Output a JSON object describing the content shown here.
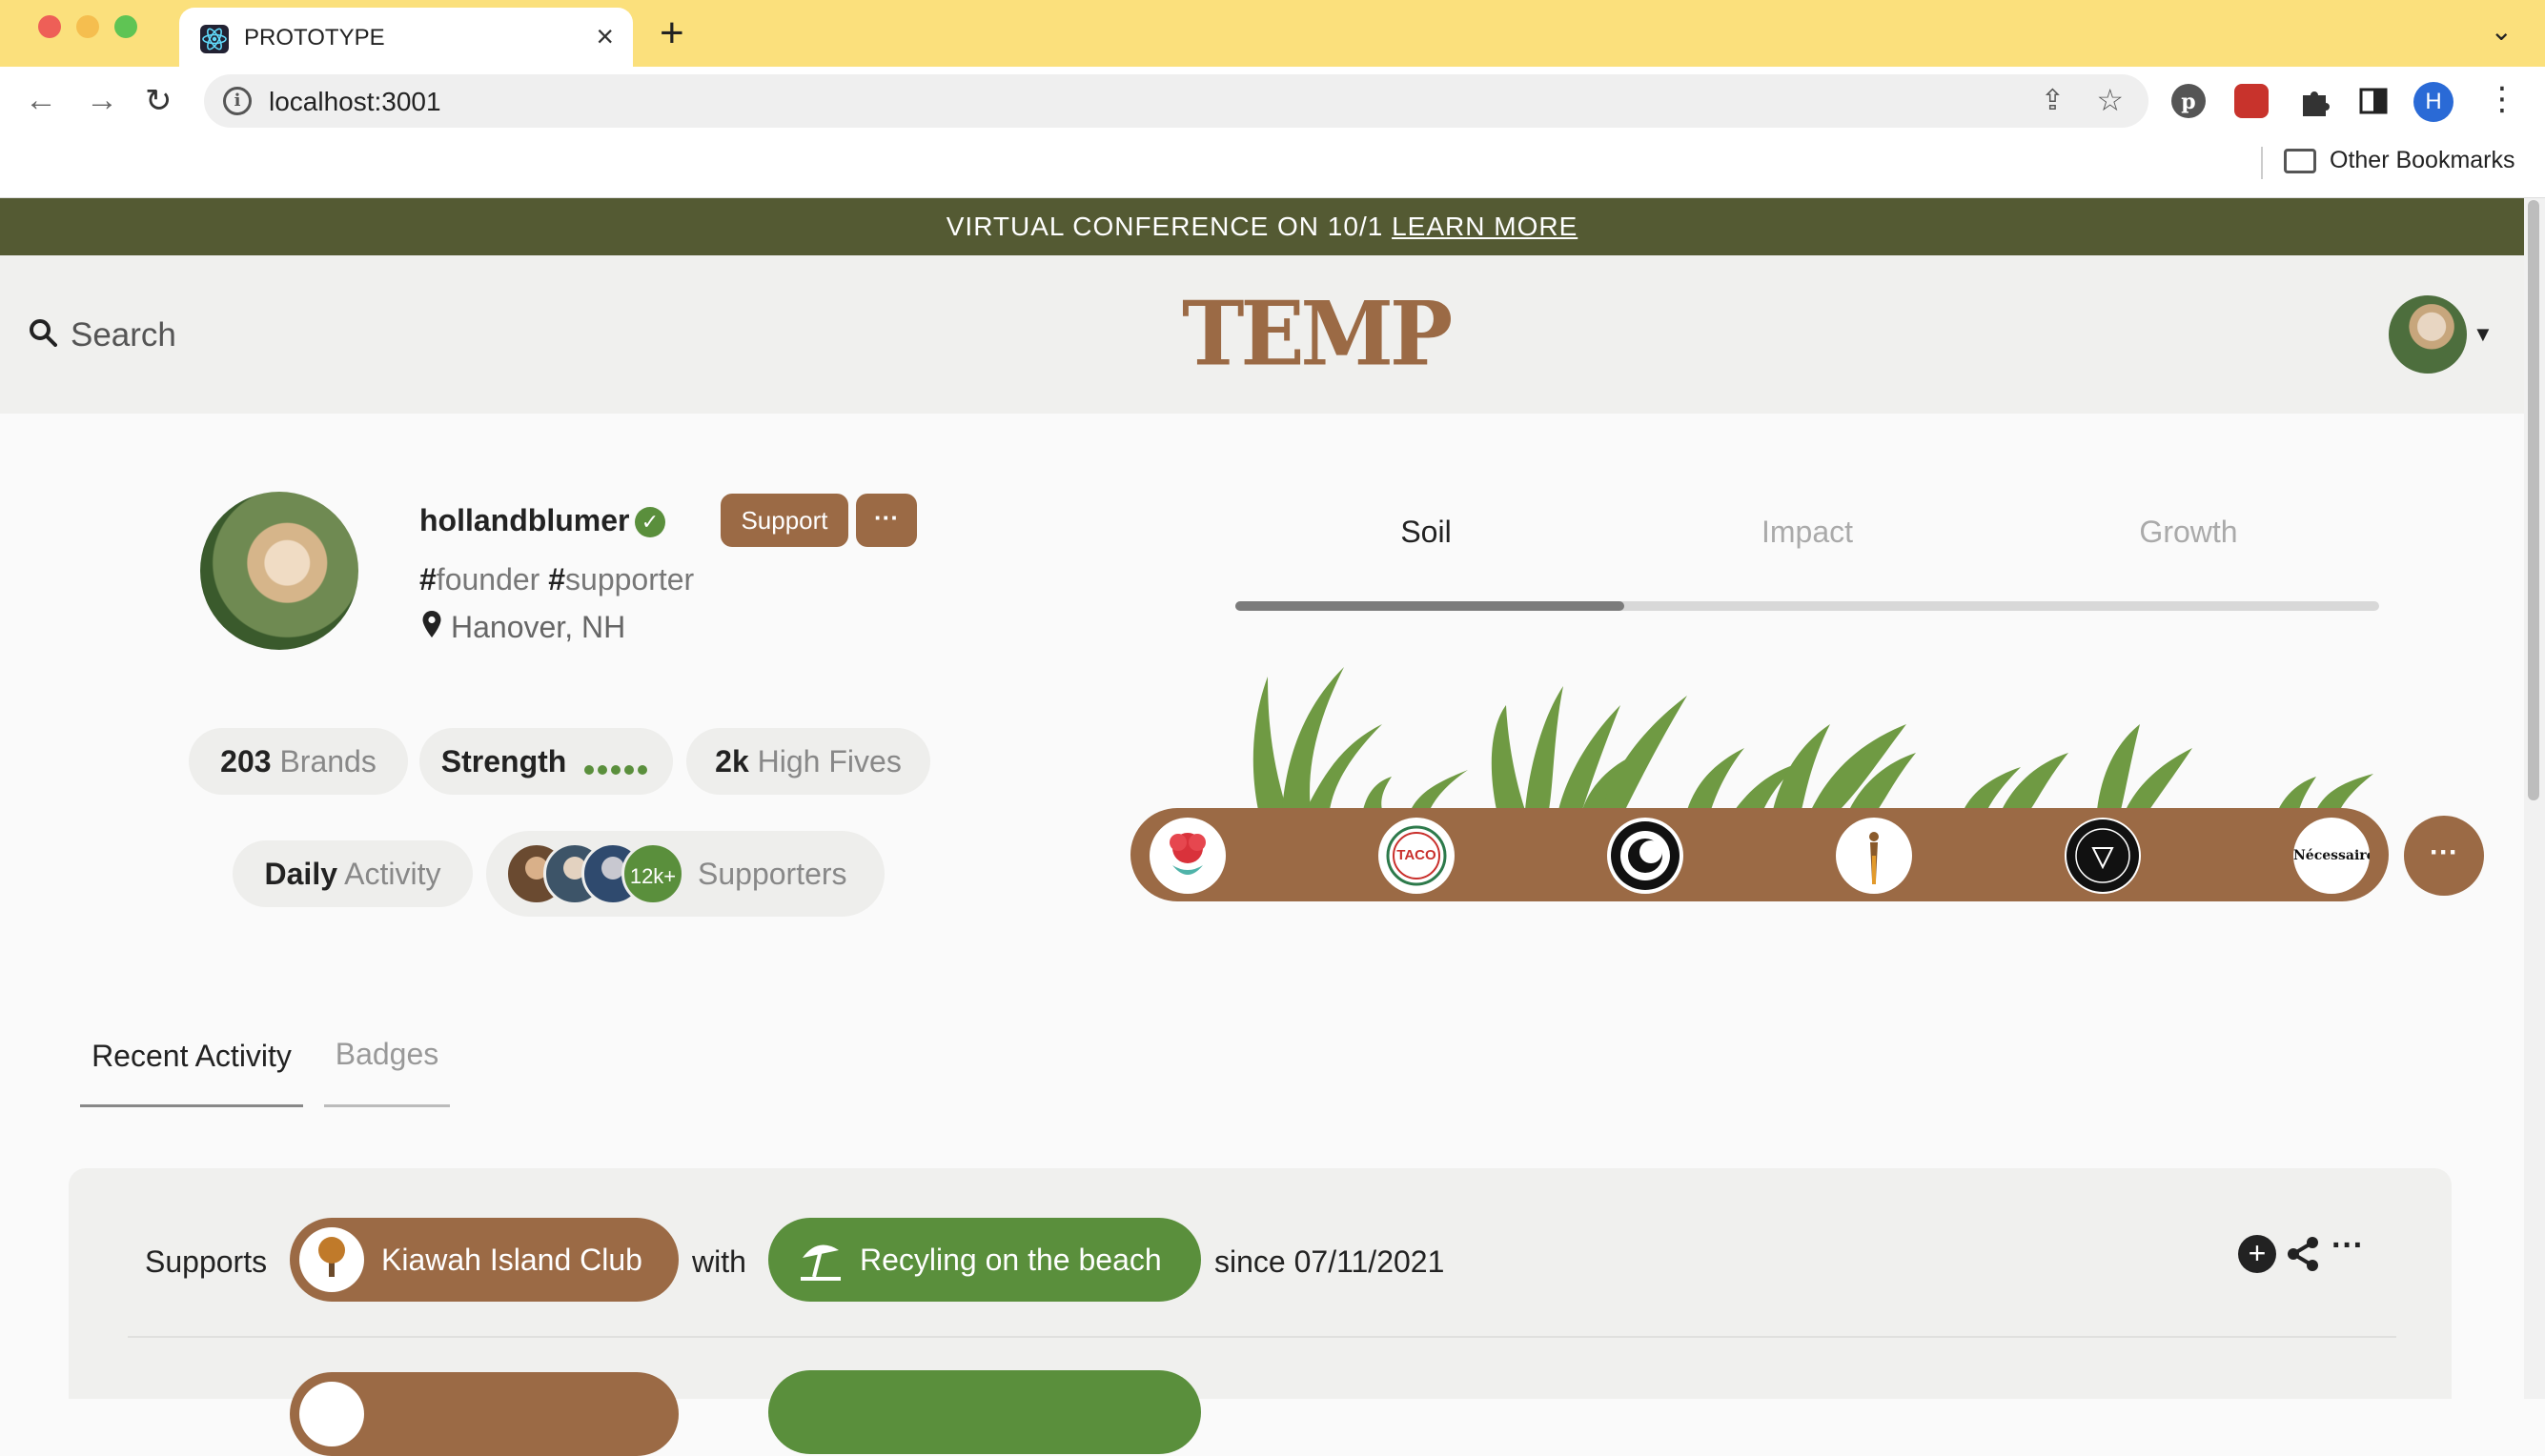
{
  "browser": {
    "tab_title": "PROTOTYPE",
    "url": "localhost:3001",
    "bookmarks_label": "Other Bookmarks",
    "profile_initial": "H",
    "icons": [
      "back-icon",
      "forward-icon",
      "reload-icon",
      "info-icon",
      "share-icon",
      "star-icon",
      "pinterest-icon",
      "extension-icon",
      "puzzle-icon",
      "sidebar-icon",
      "menu-icon",
      "folder-icon"
    ]
  },
  "banner": {
    "text": "VIRTUAL CONFERENCE ON 10/1 ",
    "link": "LEARN MORE",
    "color": "#545a33"
  },
  "header": {
    "search_placeholder": "Search",
    "logo": "TEMP"
  },
  "profile": {
    "username": "hollandblumer",
    "verified": true,
    "support_label": "Support",
    "more_label": "···",
    "tags": [
      {
        "hash": "#",
        "word": "founder"
      },
      {
        "hash": "#",
        "word": "supporter"
      }
    ],
    "location": "Hanover, NH",
    "stats": {
      "brands_count": "203",
      "brands_label": "Brands",
      "strength_label": "Strength",
      "strength_level": 5,
      "high_fives_count": "2k",
      "high_fives_label": "High Fives",
      "daily_bold": "Daily",
      "daily_light": "Activity",
      "supporters_count": "12k+",
      "supporters_label": "Supporters"
    }
  },
  "growth_tabs": {
    "tabs": [
      "Soil",
      "Impact",
      "Growth"
    ],
    "active": "Soil",
    "progress_fraction": 0.34
  },
  "soil_brands": [
    {
      "name": "carnation-logo",
      "text": "",
      "color": "#d9323b"
    },
    {
      "name": "taco-truck-logo",
      "text": "TACO",
      "color": "#c9302c"
    },
    {
      "name": "sun-ring-logo",
      "text": "",
      "color": "#111111"
    },
    {
      "name": "figure-logo",
      "text": "",
      "color": "#8a5a2b"
    },
    {
      "name": "workshop-logo",
      "text": "",
      "color": "#111111"
    },
    {
      "name": "necessaire-logo",
      "text": "Nécessaire",
      "color": "#111111"
    }
  ],
  "soil_more_label": "···",
  "activity_tabs": {
    "recent": "Recent Activity",
    "badges": "Badges"
  },
  "activity": {
    "supports": "Supports",
    "brand": "Kiawah Island Club",
    "with": "with",
    "cause": "Recyling on the beach",
    "since": "since 07/11/2021"
  },
  "colors": {
    "brand_brown": "#9b6a45",
    "green": "#5a8f3c",
    "tabbar": "#fbe07c"
  }
}
